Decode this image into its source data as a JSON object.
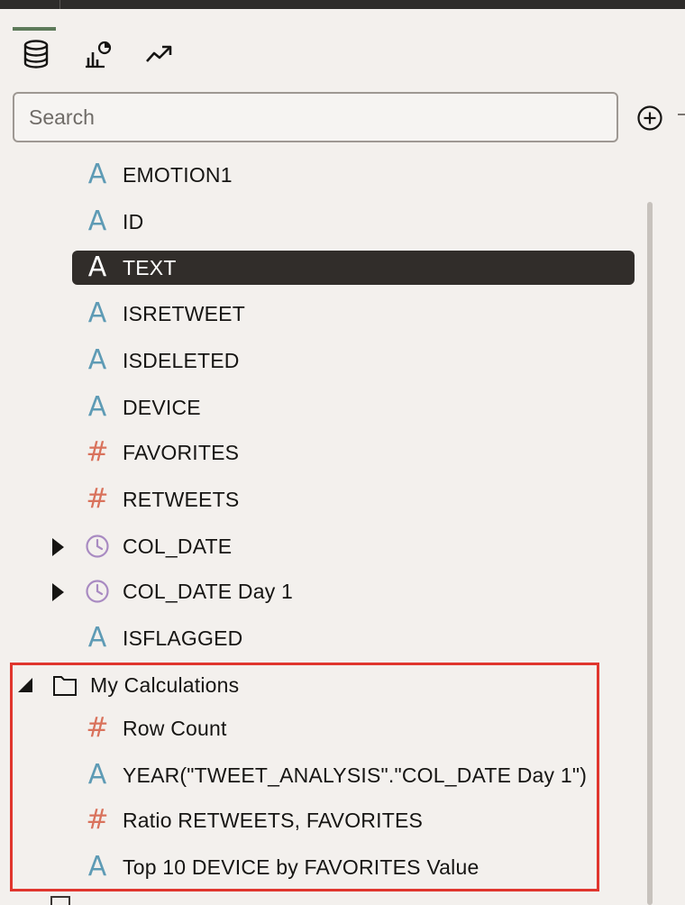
{
  "tabs": [
    {
      "icon": "database-icon",
      "active": true
    },
    {
      "icon": "chart-icon",
      "active": false
    },
    {
      "icon": "trend-icon",
      "active": false
    }
  ],
  "search": {
    "placeholder": "Search",
    "value": ""
  },
  "colors": {
    "attribute": "#5e9bb5",
    "measure": "#d9725c",
    "time": "#a98bc2",
    "selected_bg": "#312d2a",
    "highlight": "#e0362e"
  },
  "columns": [
    {
      "label": "EMOTION1",
      "type": "attribute",
      "glyph": "A"
    },
    {
      "label": "ID",
      "type": "attribute",
      "glyph": "A"
    },
    {
      "label": "TEXT",
      "type": "attribute",
      "glyph": "A",
      "selected": true
    },
    {
      "label": "ISRETWEET",
      "type": "attribute",
      "glyph": "A"
    },
    {
      "label": "ISDELETED",
      "type": "attribute",
      "glyph": "A"
    },
    {
      "label": "DEVICE",
      "type": "attribute",
      "glyph": "A"
    },
    {
      "label": "FAVORITES",
      "type": "measure",
      "glyph": "#"
    },
    {
      "label": "RETWEETS",
      "type": "measure",
      "glyph": "#"
    },
    {
      "label": "COL_DATE",
      "type": "time",
      "expandable": true
    },
    {
      "label": "COL_DATE Day 1",
      "type": "time",
      "expandable": true
    },
    {
      "label": "ISFLAGGED",
      "type": "attribute",
      "glyph": "A"
    }
  ],
  "folder": {
    "label": "My Calculations",
    "expanded": true,
    "items": [
      {
        "label": "Row Count",
        "type": "measure",
        "glyph": "#"
      },
      {
        "label": "YEAR(\"TWEET_ANALYSIS\".\"COL_DATE Day 1\")",
        "type": "attribute",
        "glyph": "A"
      },
      {
        "label": "Ratio RETWEETS, FAVORITES",
        "type": "measure",
        "glyph": "#"
      },
      {
        "label": "Top 10 DEVICE by FAVORITES Value",
        "type": "attribute",
        "glyph": "A"
      }
    ]
  }
}
